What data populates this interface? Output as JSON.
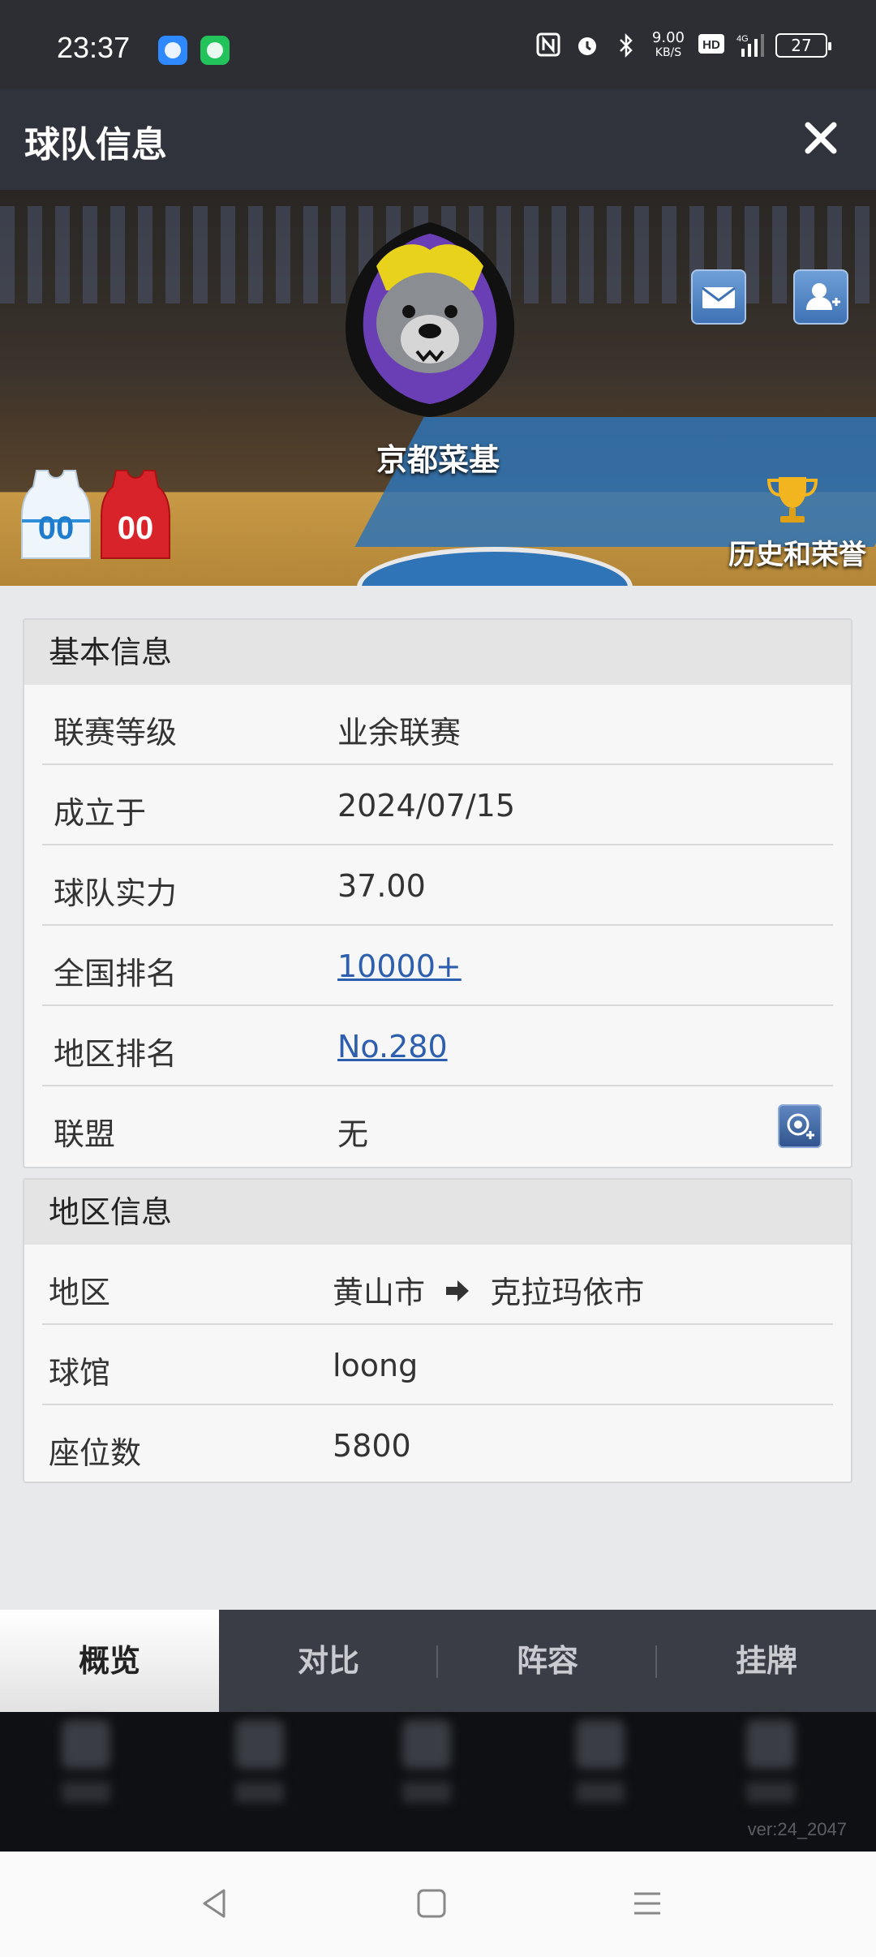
{
  "status_bar": {
    "time": "23:37",
    "net_speed_value": "9.00",
    "net_speed_unit": "KB/S",
    "battery": "27",
    "icons": [
      "nfc-icon",
      "alarm-icon",
      "bluetooth-icon",
      "hd-icon",
      "signal-4g-icon",
      "battery-icon"
    ]
  },
  "header": {
    "title": "球队信息",
    "close_icon": "close-icon"
  },
  "banner": {
    "team_name": "京都菜基",
    "honors_label": "历史和荣誉",
    "home_jersey_number": "00",
    "away_jersey_number": "00"
  },
  "basic_info": {
    "title": "基本信息",
    "rows": [
      {
        "key": "联赛等级",
        "value": "业余联赛"
      },
      {
        "key": "成立于",
        "value": "2024/07/15"
      },
      {
        "key": "球队实力",
        "value": "37.00"
      },
      {
        "key": "全国排名",
        "value": "10000+"
      },
      {
        "key": "地区排名",
        "value": "No.280"
      },
      {
        "key": "联盟",
        "value": "无"
      }
    ]
  },
  "region_info": {
    "title": "地区信息",
    "rows": [
      {
        "key": "地区",
        "value_from": "黄山市",
        "value_to": "克拉玛依市"
      },
      {
        "key": "球馆",
        "value": "loong"
      },
      {
        "key": "座位数",
        "value": "5800"
      }
    ]
  },
  "tabs": [
    {
      "label": "概览",
      "active": true
    },
    {
      "label": "对比",
      "active": false
    },
    {
      "label": "阵容",
      "active": false
    },
    {
      "label": "挂牌",
      "active": false
    }
  ],
  "version": "ver:24_2047",
  "colors": {
    "link": "#2d5fae",
    "title_bar": "#30333b",
    "tab_bar": "#3a3d45"
  }
}
